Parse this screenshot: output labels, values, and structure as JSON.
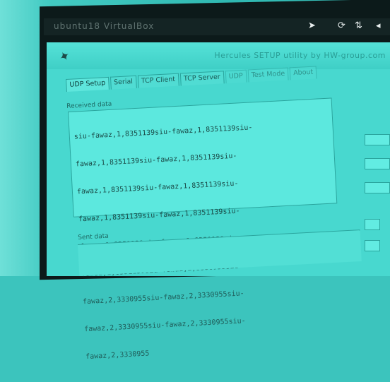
{
  "taskbar": {
    "title": "ubuntu18 VirtualBox",
    "icons": [
      "cursor-icon",
      "sync-icon",
      "network-icon",
      "volume-icon"
    ]
  },
  "window": {
    "title": "Hercules SETUP utility by HW-group.com"
  },
  "tabs": [
    {
      "label": "UDP Setup",
      "active": true
    },
    {
      "label": "Serial",
      "active": false
    },
    {
      "label": "TCP Client",
      "active": false
    },
    {
      "label": "TCP Server",
      "active": false
    },
    {
      "label": "UDP",
      "active": false
    },
    {
      "label": "Test Mode",
      "active": false
    },
    {
      "label": "About",
      "active": false
    }
  ],
  "received": {
    "label": "Received data",
    "lines": [
      "siu-fawaz,1,8351139siu-fawaz,1,8351139siu-",
      "fawaz,1,8351139siu-fawaz,1,8351139siu-",
      "fawaz,1,8351139siu-fawaz,1,8351139siu-",
      "fawaz,1,8351139siu-fawaz,1,8351139siu-",
      "fawaz,1,8351139siu-fawaz,1,8351139siu-",
      "fawaz,1,8351139siu-fawaz,2,3330955siu-",
      "fawaz,2,3330955siu-fawaz,2,3330955siu-",
      "fawaz,2,3330955siu-fawaz,2,3330955siu-",
      "fawaz,2,3330955"
    ]
  },
  "sent": {
    "label": "Sent data"
  },
  "colors": {
    "background": "#3cc4bd",
    "window": "#48d8cf",
    "text": "#1a4b48"
  }
}
